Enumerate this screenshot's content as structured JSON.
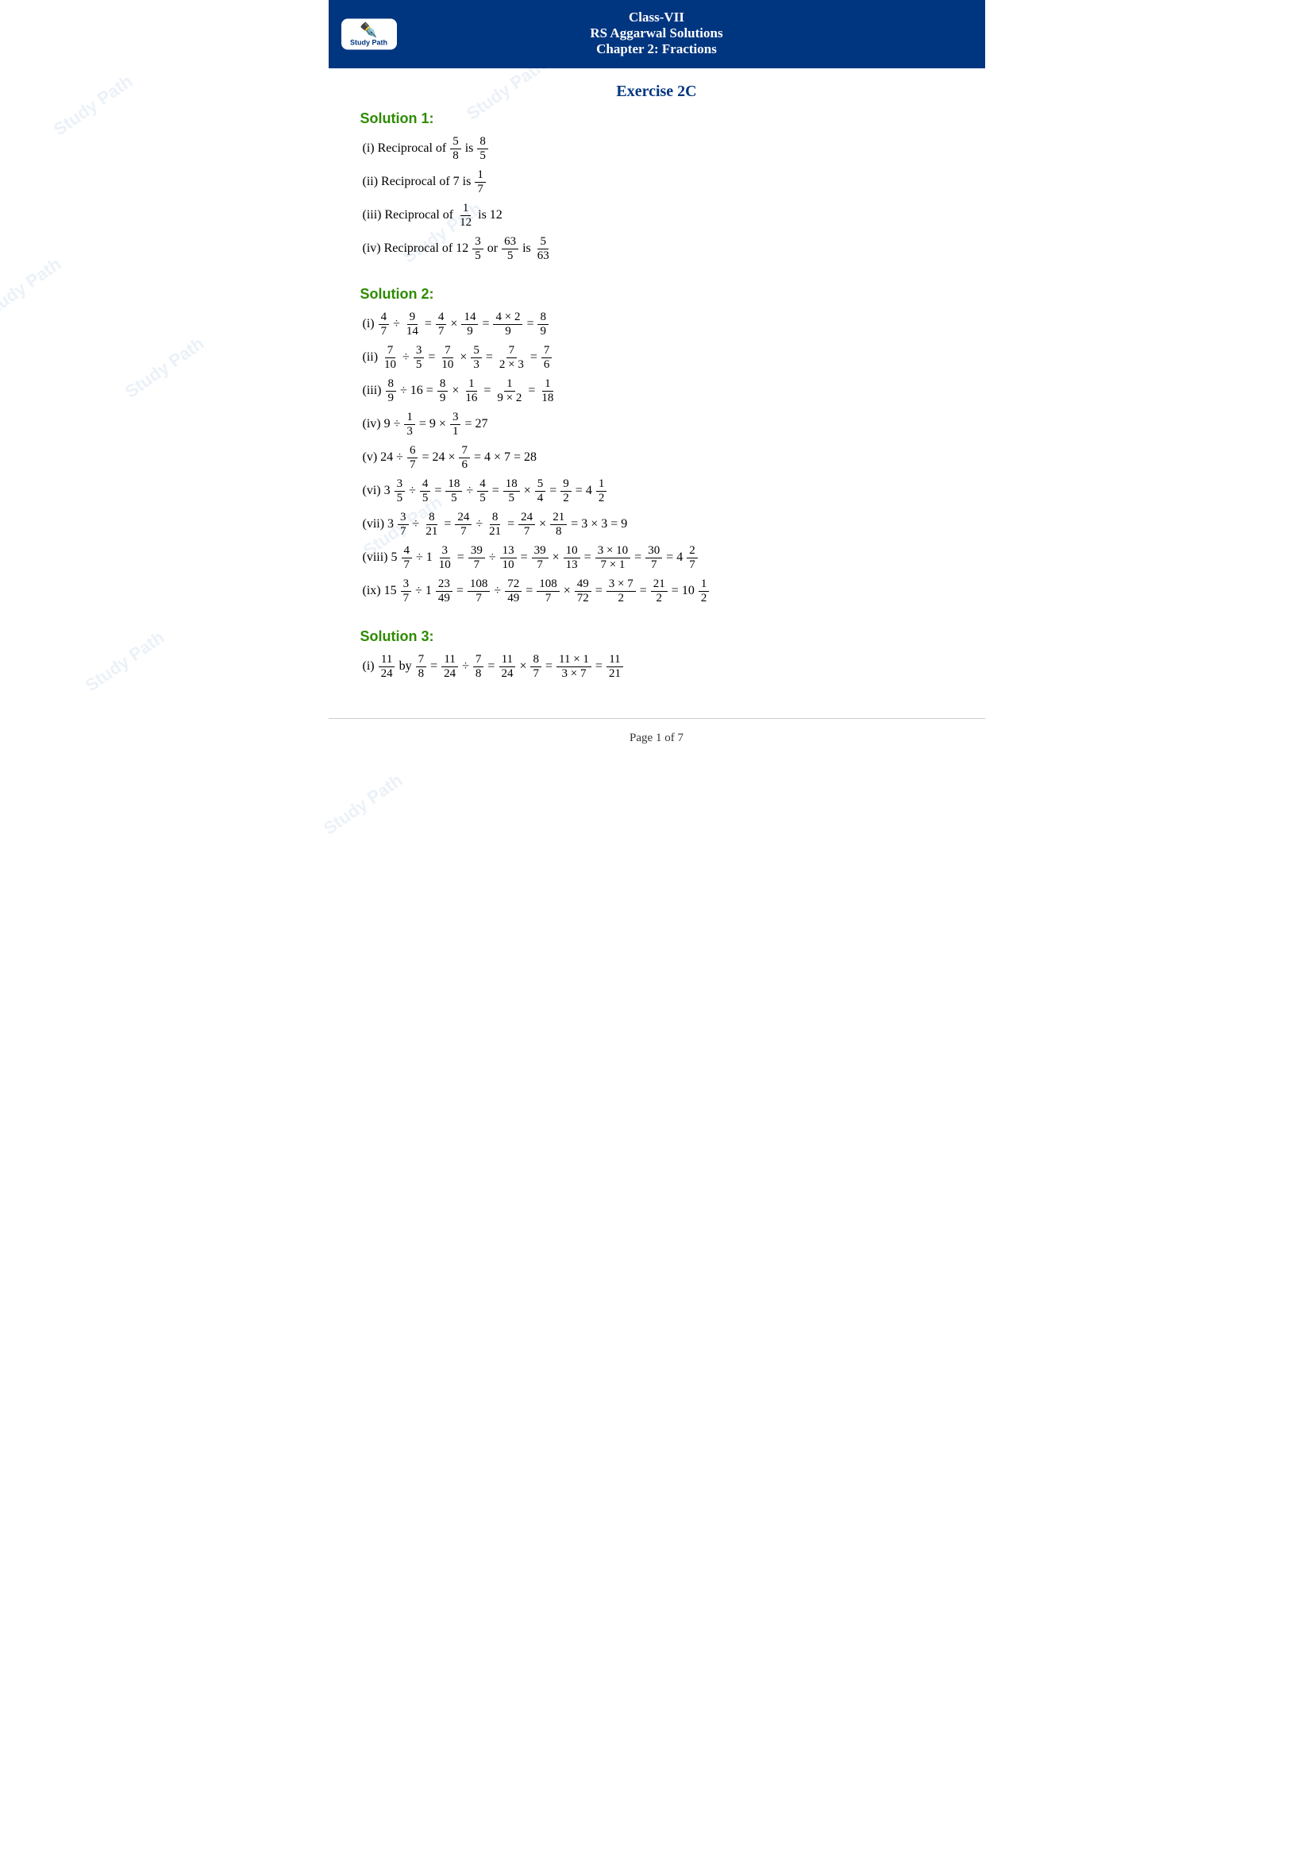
{
  "header": {
    "line1": "Class-VII",
    "line2": "RS Aggarwal Solutions",
    "line3": "Chapter 2: Fractions",
    "logo_text": "Study Path",
    "logo_icon": "✏️"
  },
  "exercise": {
    "title": "Exercise 2C"
  },
  "solution1": {
    "title": "Solution 1:",
    "items": [
      "(i) Reciprocal of",
      "(ii) Reciprocal of 7 is",
      "(iii) Reciprocal of",
      "(iv) Reciprocal of 12"
    ]
  },
  "solution2": {
    "title": "Solution 2:"
  },
  "solution3": {
    "title": "Solution 3:"
  },
  "footer": {
    "text": "Page 1 of 7"
  }
}
